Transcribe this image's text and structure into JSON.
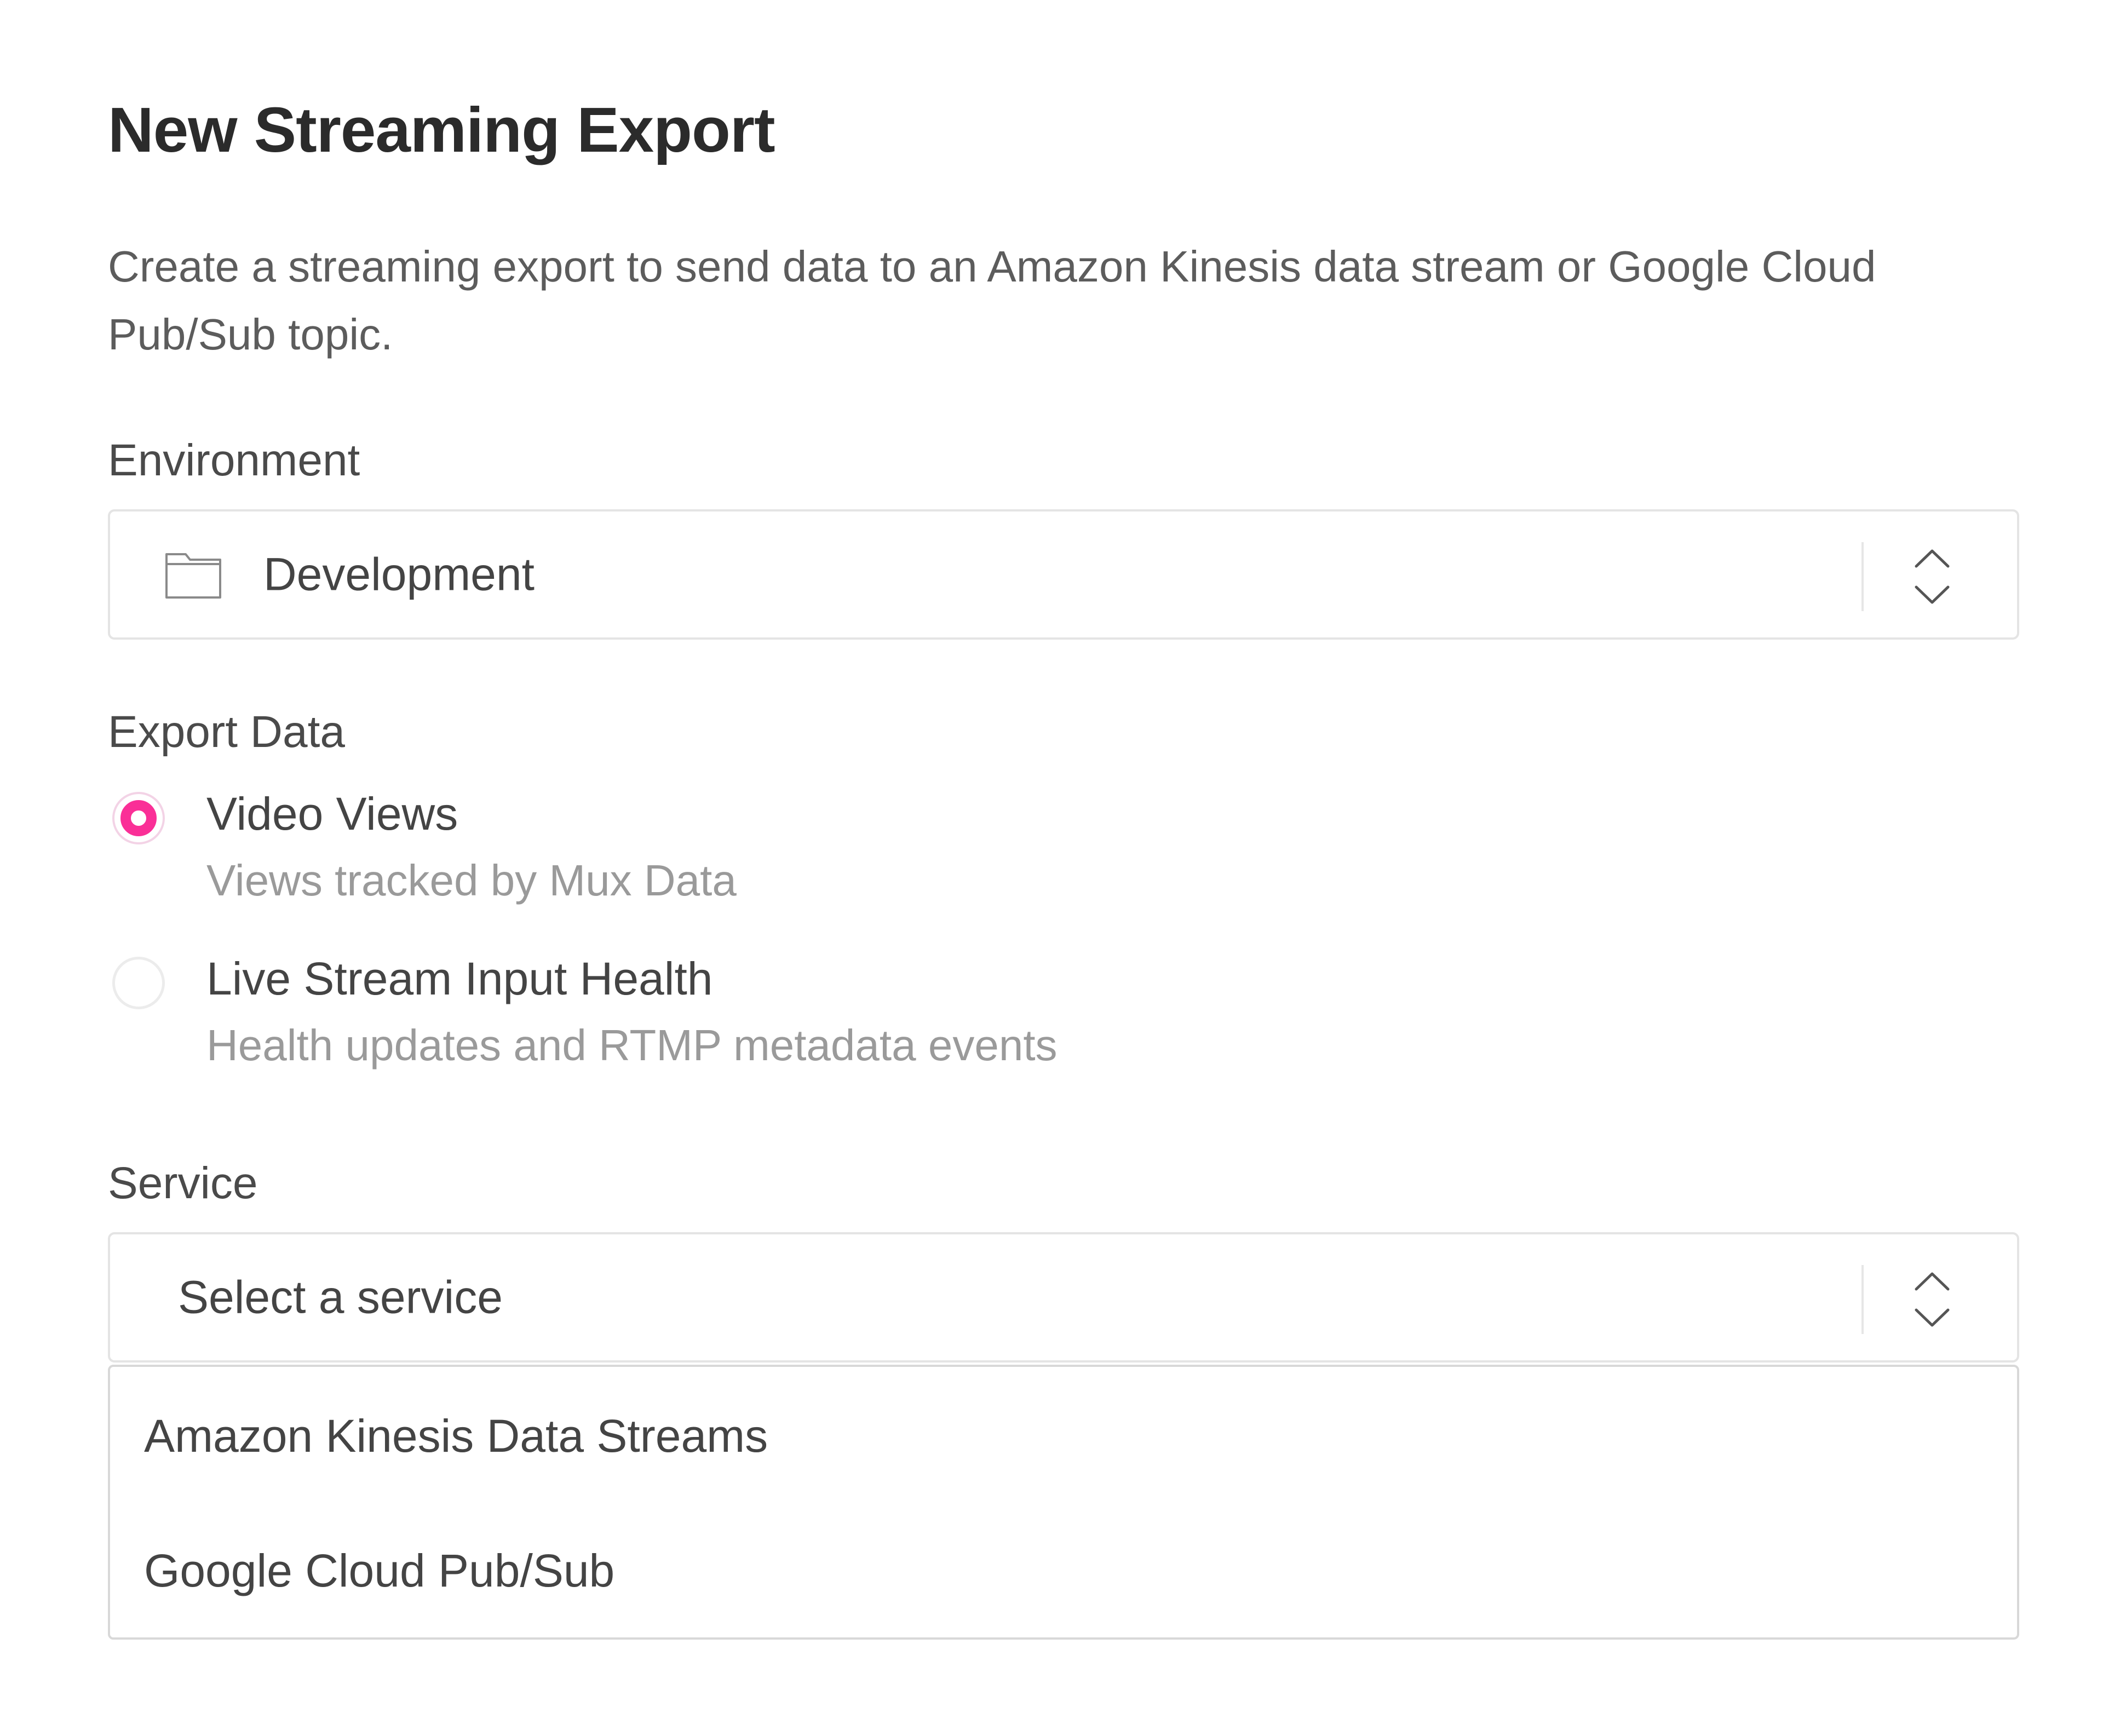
{
  "page": {
    "title": "New Streaming Export",
    "description": "Create a streaming export to send data to an Amazon Kinesis data stream or Google Cloud Pub/Sub topic."
  },
  "environment": {
    "label": "Environment",
    "value": "Development",
    "icon": "folder-icon"
  },
  "export_data": {
    "label": "Export Data",
    "options": [
      {
        "label": "Video Views",
        "description": "Views tracked by Mux Data",
        "selected": true
      },
      {
        "label": "Live Stream Input Health",
        "description": "Health updates and RTMP metadata events",
        "selected": false
      }
    ]
  },
  "service": {
    "label": "Service",
    "placeholder": "Select a service",
    "options": [
      "Amazon Kinesis Data Streams",
      "Google Cloud Pub/Sub"
    ]
  },
  "colors": {
    "accent": "#fa2f97",
    "border": "#e4e4e4",
    "text": "#444444",
    "muted": "#9a9a9a"
  }
}
